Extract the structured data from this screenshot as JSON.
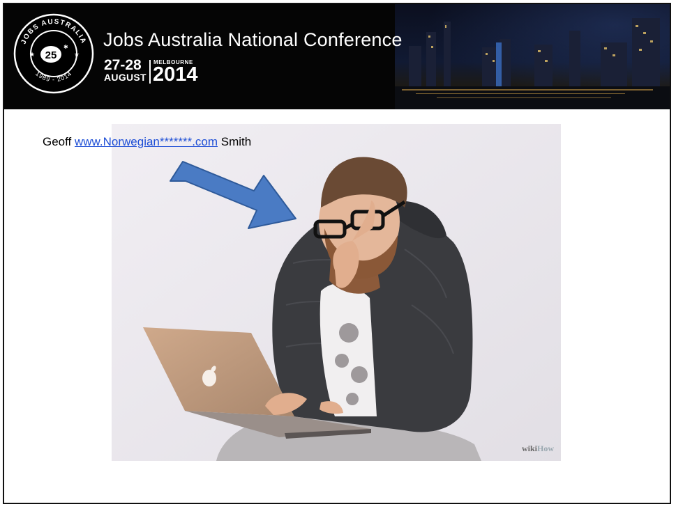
{
  "header": {
    "logo": {
      "arc_top": "JOBS AUSTRALIA",
      "arc_bottom": "1989 - 2014",
      "badge_number": "25"
    },
    "title": "Jobs Australia National Conference",
    "dates": "27-28",
    "month": "AUGUST",
    "city": "MELBOURNE",
    "year": "2014"
  },
  "slide": {
    "caption_before": "Geoff ",
    "caption_link": "www.Norwegian*******.com",
    "caption_after": " Smith",
    "photo_watermark_left": "wiki",
    "photo_watermark_right": "How"
  },
  "colors": {
    "banner_bg": "#050505",
    "link": "#1f4fd6",
    "arrow_fill": "#4a7bc4",
    "arrow_stroke": "#2e5a9a",
    "photo_bg": "#ece9ee"
  },
  "icons": {
    "arrow": "arrow-down-right-icon",
    "logo": "jobs-australia-25-years-badge"
  }
}
